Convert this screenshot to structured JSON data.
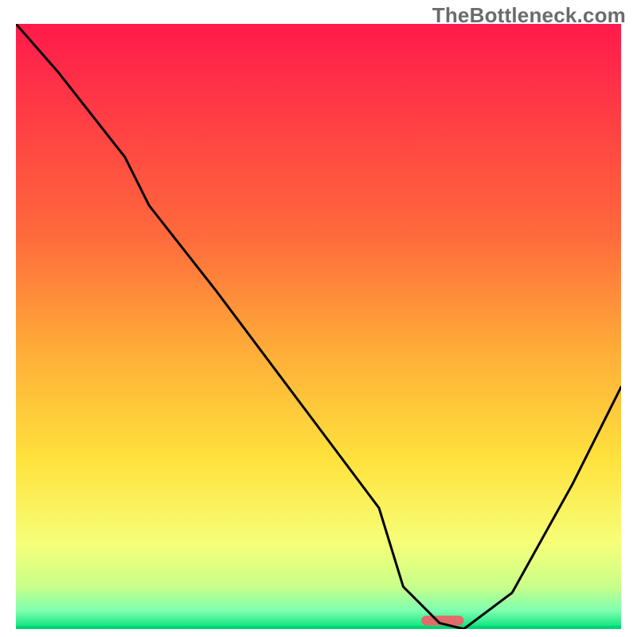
{
  "watermark": "TheBottleneck.com",
  "chart_data": {
    "type": "line",
    "title": "",
    "xlabel": "",
    "ylabel": "",
    "xlim": [
      0,
      100
    ],
    "ylim": [
      0,
      100
    ],
    "gradient_stops": [
      {
        "offset": 0.0,
        "color": "#ff1a4b"
      },
      {
        "offset": 0.35,
        "color": "#ff6a3c"
      },
      {
        "offset": 0.55,
        "color": "#ffb038"
      },
      {
        "offset": 0.72,
        "color": "#ffe23d"
      },
      {
        "offset": 0.86,
        "color": "#f6ff78"
      },
      {
        "offset": 0.93,
        "color": "#c8ff8a"
      },
      {
        "offset": 0.97,
        "color": "#7dffb0"
      },
      {
        "offset": 1.0,
        "color": "#00e07a"
      }
    ],
    "series": [
      {
        "name": "bottleneck-curve",
        "color": "#000000",
        "x": [
          0,
          7,
          18,
          22,
          33,
          48,
          60,
          64,
          70,
          74,
          82,
          92,
          100
        ],
        "values": [
          100,
          92,
          78,
          70,
          56,
          36,
          20,
          7,
          1,
          0,
          6,
          24,
          40
        ]
      }
    ],
    "marker": {
      "name": "optimal-range",
      "color": "#e36a6a",
      "x_start": 67,
      "x_end": 74,
      "y": 0.6,
      "height": 1.6
    }
  }
}
